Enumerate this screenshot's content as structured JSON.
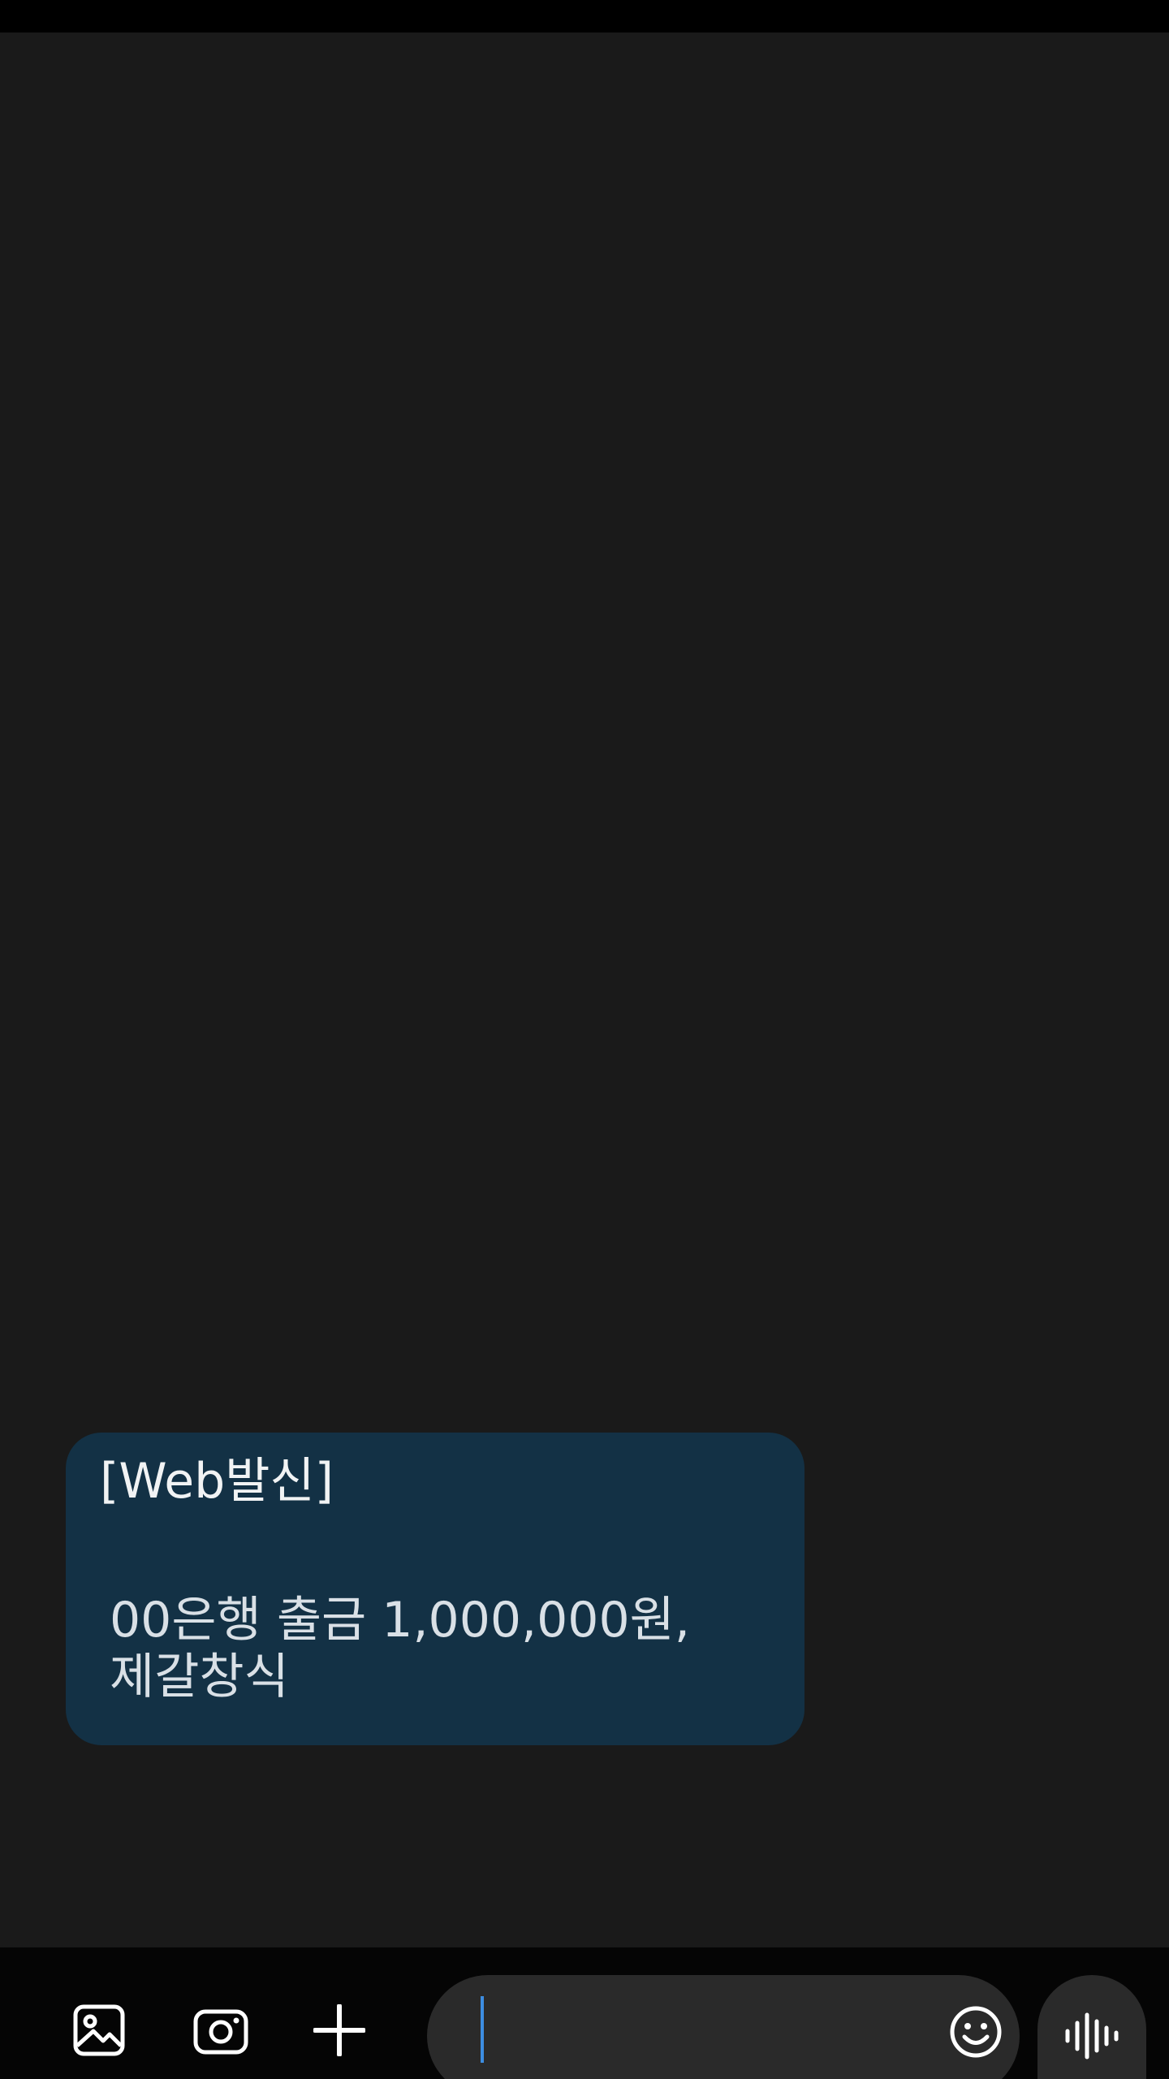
{
  "conversation": {
    "messages": [
      {
        "title": "[Web발신]",
        "body_line1": "00은행 출금 1,000,000원,",
        "body_line2": "제갈창식"
      }
    ]
  },
  "composer": {
    "input_value": "",
    "input_placeholder": "",
    "icons": {
      "gallery": "gallery-icon",
      "camera": "camera-icon",
      "add": "plus-icon",
      "emoji": "emoji-icon",
      "voice": "voice-waveform-icon"
    }
  },
  "colors": {
    "background": "#1a1a1a",
    "bubble": "#133145",
    "caret": "#3d8de0",
    "input_pill": "#2a2a2a"
  }
}
